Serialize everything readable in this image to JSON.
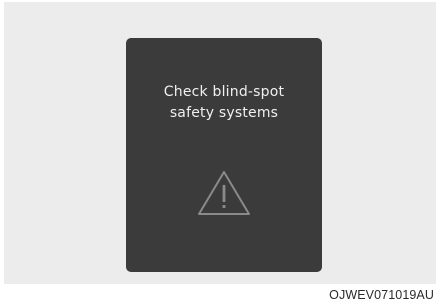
{
  "display": {
    "message_line1": "Check blind-spot",
    "message_line2": "safety systems",
    "icon": "warning-triangle-icon"
  },
  "figure_code": "OJWEV071019AU",
  "colors": {
    "background": "#ececec",
    "screen": "#3b3b3b",
    "text": "#f0f0f0",
    "icon_stroke": "#8a8a8a"
  }
}
